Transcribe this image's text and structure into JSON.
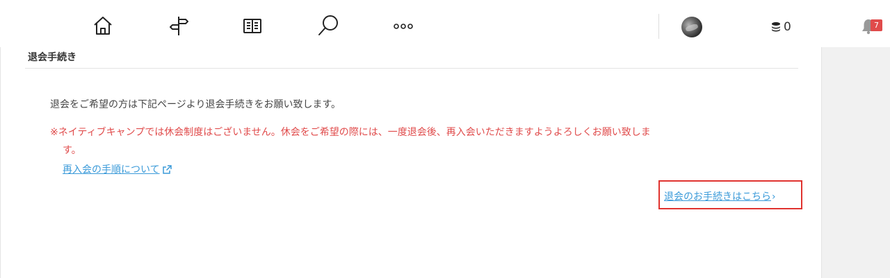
{
  "nav": {
    "icons": [
      "home-icon",
      "signpost-icon",
      "book-icon",
      "search-icon",
      "more-icon"
    ],
    "coins": "0",
    "notifications": "7"
  },
  "section": {
    "title": "退会手続き",
    "intro": "退会をご希望の方は下記ページより退会手続きをお願い致します。",
    "warning_line1": "※ネイティブキャンプでは休会制度はございません。休会をご希望の際には、一度退会後、再入会いただきますようよろしくお願い致しま",
    "warning_line2": "す。",
    "rejoin_link": "再入会の手順について",
    "withdraw_link": "退会のお手続きはこちら",
    "withdraw_chevron": "›"
  },
  "colors": {
    "warning": "#e04b4b",
    "link": "#3a9ad9",
    "highlight_box": "#e0332f",
    "badge": "#e04b4b"
  }
}
